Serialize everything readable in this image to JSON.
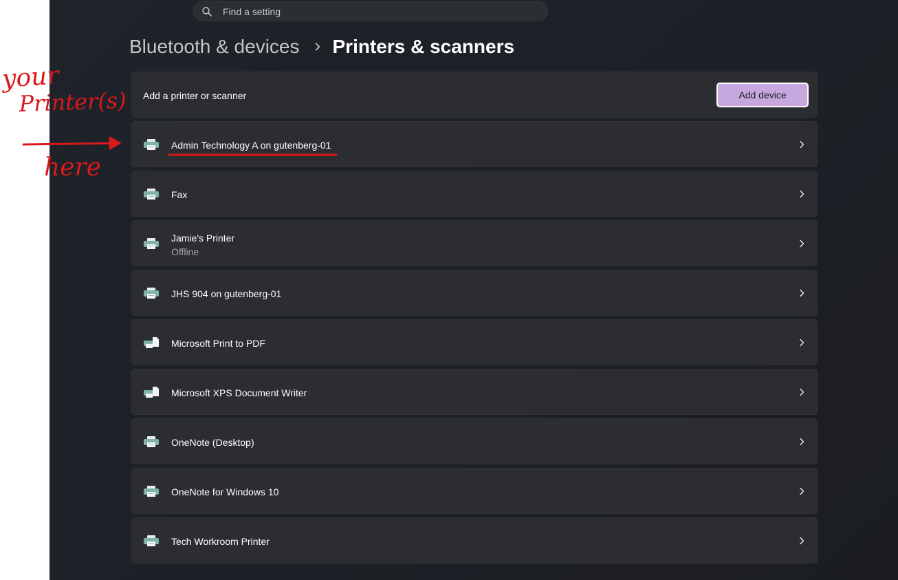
{
  "search": {
    "placeholder": "Find a setting"
  },
  "breadcrumb": {
    "parent": "Bluetooth & devices",
    "current": "Printers & scanners"
  },
  "add_printer": {
    "label": "Add a printer or scanner",
    "button_label": "Add device"
  },
  "printers": [
    {
      "name": "Admin Technology A on gutenberg-01",
      "status": "",
      "icon": "printer-icon"
    },
    {
      "name": "Fax",
      "status": "",
      "icon": "printer-icon"
    },
    {
      "name": "Jamie's Printer",
      "status": "Offline",
      "icon": "printer-icon"
    },
    {
      "name": "JHS 904 on gutenberg-01",
      "status": "",
      "icon": "printer-icon"
    },
    {
      "name": "Microsoft Print to PDF",
      "status": "",
      "icon": "virtual-printer-icon"
    },
    {
      "name": "Microsoft XPS Document Writer",
      "status": "",
      "icon": "virtual-printer-icon"
    },
    {
      "name": "OneNote (Desktop)",
      "status": "",
      "icon": "printer-icon"
    },
    {
      "name": "OneNote for Windows 10",
      "status": "",
      "icon": "printer-icon"
    },
    {
      "name": "Tech Workroom Printer",
      "status": "",
      "icon": "printer-icon"
    }
  ],
  "annotation": {
    "line1": "your",
    "line2": "Printer(s)",
    "line3": "here",
    "color": "#d8191c"
  },
  "colors": {
    "accent": "#c6a8df",
    "icon_tint": "#7fb3aa",
    "card_bg": "#2b2d31"
  }
}
